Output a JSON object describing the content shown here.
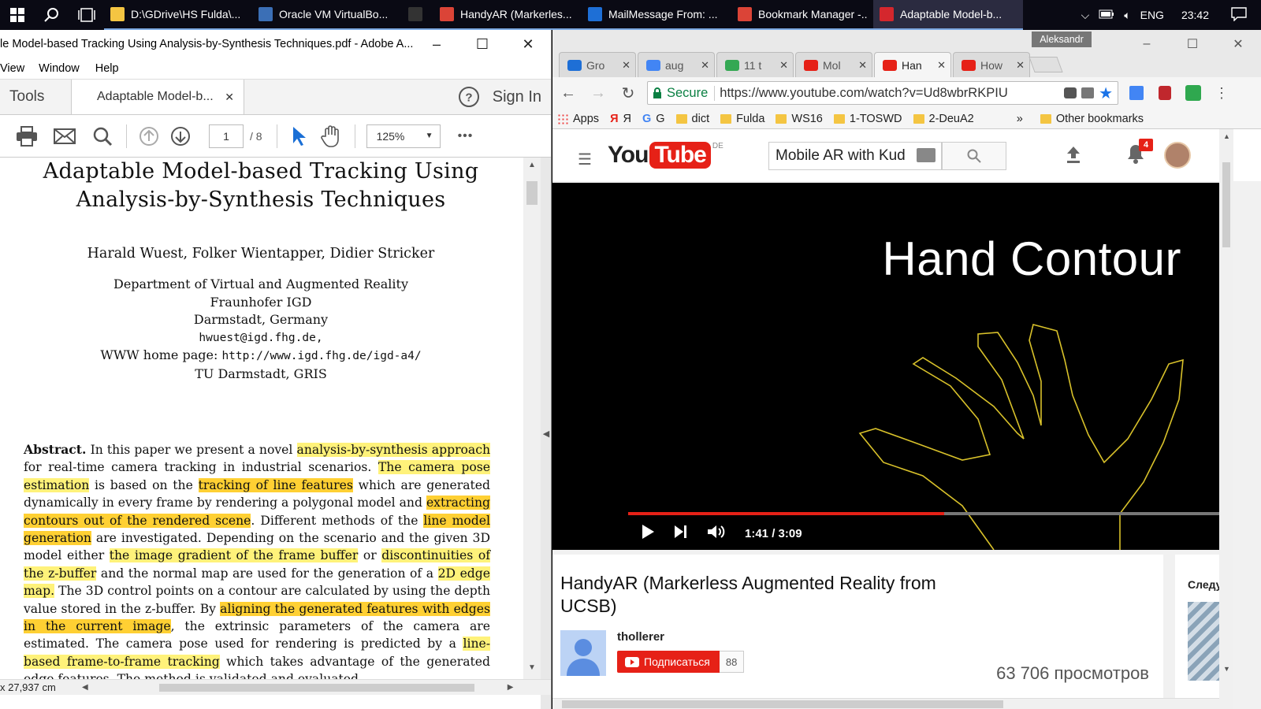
{
  "taskbar": {
    "apps": [
      {
        "label": "D:\\GDrive\\HS Fulda\\...",
        "icon": "folder-icon",
        "color": "#f4c542"
      },
      {
        "label": "Oracle VM VirtualBo...",
        "icon": "virtualbox-icon",
        "color": "#3b6fb6"
      },
      {
        "label": "",
        "icon": "cmd-icon",
        "color": "#333333"
      },
      {
        "label": "HandyAR (Markerles...",
        "icon": "chrome-icon",
        "color": "#db4437"
      },
      {
        "label": "MailMessage From: ...",
        "icon": "mail-icon",
        "color": "#1e6fd6"
      },
      {
        "label": "Bookmark Manager -...",
        "icon": "chrome-icon",
        "color": "#db4437"
      },
      {
        "label": "Adaptable Model-b...",
        "icon": "acrobat-icon",
        "color": "#d4272d"
      }
    ],
    "tray": {
      "lang": "ENG",
      "time": "23:42"
    }
  },
  "acrobat": {
    "title": "le Model-based Tracking Using Analysis-by-Synthesis Techniques.pdf - Adobe A...",
    "menu": [
      "View",
      "Window",
      "Help"
    ],
    "tab_tools": "Tools",
    "tab_doc": "Adaptable Model-b...",
    "sign_in": "Sign In",
    "page_current": "1",
    "page_total": "/ 8",
    "zoom": "125%",
    "more": "•••",
    "status": "x 27,937 cm",
    "document": {
      "title_line1": "Adaptable Model-based Tracking Using",
      "title_line2": "Analysis-by-Synthesis Techniques",
      "authors": "Harald Wuest, Folker Wientapper, Didier Stricker",
      "affil1": "Department of Virtual and Augmented Reality",
      "affil2": "Fraunhofer IGD",
      "affil3": "Darmstadt, Germany",
      "email": "hwuest@igd.fhg.de,",
      "www_label": "WWW home page: ",
      "www_url": "http://www.igd.fhg.de/igd-a4/",
      "affil4": "TU Darmstadt, GRIS",
      "abstract_label": "Abstract.",
      "abstract": [
        {
          "t": " In this paper we present a novel ",
          "h": ""
        },
        {
          "t": "analysis-by-synthesis approach",
          "h": "hl"
        },
        {
          "t": " for real-time camera tracking in industrial scenarios. ",
          "h": ""
        },
        {
          "t": "The camera pose estimation",
          "h": "hl"
        },
        {
          "t": " is based on the ",
          "h": ""
        },
        {
          "t": "tracking of line features",
          "h": "hl2"
        },
        {
          "t": " which are generated dynamically in every frame by rendering a polygonal model and ",
          "h": ""
        },
        {
          "t": "extracting contours out of the rendered scene",
          "h": "hl2"
        },
        {
          "t": ". Different methods of the ",
          "h": ""
        },
        {
          "t": "line model generation",
          "h": "hl2"
        },
        {
          "t": " are investigated. Depending on the scenario and the given 3D model either ",
          "h": ""
        },
        {
          "t": "the image gradient of the frame buffer",
          "h": "hl"
        },
        {
          "t": " or ",
          "h": ""
        },
        {
          "t": "discontinuities of the z-buffer",
          "h": "hl"
        },
        {
          "t": " and the normal map are used for the generation of a ",
          "h": ""
        },
        {
          "t": "2D edge map.",
          "h": "hl"
        },
        {
          "t": " The 3D control points on a contour are calculated by using the depth value stored in the z-buffer. By ",
          "h": ""
        },
        {
          "t": "aligning the generated features with edges in the current image",
          "h": "hl2"
        },
        {
          "t": ", the extrinsic parameters of the camera are estimated. The camera pose used for rendering is predicted by a ",
          "h": ""
        },
        {
          "t": "line-based frame-to-frame tracking",
          "h": "hl"
        },
        {
          "t": " which takes advantage of the generated edge features. The method is validated and evaluated",
          "h": ""
        }
      ]
    }
  },
  "chrome": {
    "profile": "Aleksandr",
    "tabs": [
      {
        "label": "Gro",
        "color": "#1e6fd6"
      },
      {
        "label": "aug",
        "color": "#4285f4"
      },
      {
        "label": "11 t",
        "color": "#34a853"
      },
      {
        "label": "Mol",
        "color": "#e62117"
      },
      {
        "label": "Han",
        "color": "#e62117"
      },
      {
        "label": "How",
        "color": "#e62117"
      }
    ],
    "secure_label": "Secure",
    "url": "https://www.youtube.com/watch?v=Ud8wbrRKPIU",
    "bookmarks": [
      {
        "label": "Apps",
        "type": "apps"
      },
      {
        "label": "Я",
        "type": "yandex"
      },
      {
        "label": "G",
        "type": "google"
      },
      {
        "label": "dict",
        "type": "folder"
      },
      {
        "label": "Fulda",
        "type": "folder"
      },
      {
        "label": "WS16",
        "type": "folder"
      },
      {
        "label": "1-TOSWD",
        "type": "folder"
      },
      {
        "label": "2-DeuA2",
        "type": "folder"
      }
    ],
    "bookmarks_more": "»",
    "other_bookmarks": "Other bookmarks"
  },
  "youtube": {
    "logo_you": "You",
    "logo_tube": "Tube",
    "region": "DE",
    "search_value": "Mobile AR with Kud",
    "notif_count": "4",
    "video_overlay_text": "Hand Contour",
    "time": "1:41 / 3:09",
    "progress": 0.534,
    "video_title": "HandyAR (Markerless Augmented Reality from UCSB)",
    "channel": "thollerer",
    "subscribe": "Подписаться",
    "sub_count": "88",
    "views": "63 706 просмотров",
    "next_label": "Следу"
  }
}
